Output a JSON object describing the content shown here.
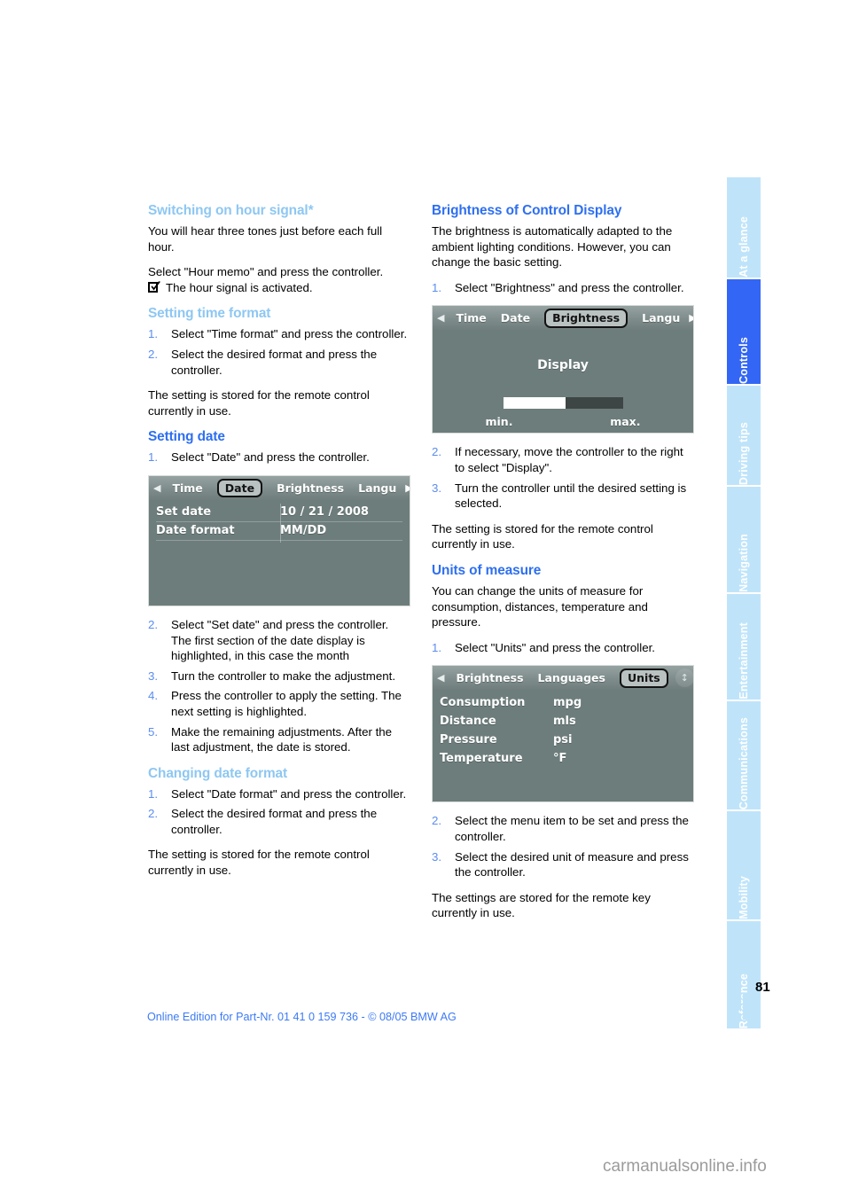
{
  "document": {
    "page_number": "81",
    "footer_note": "Online Edition for Part-Nr. 01 41 0 159 736 - © 08/05 BMW AG",
    "watermark": "carmanualsonline.info"
  },
  "sidebar": {
    "tabs": [
      {
        "label": "At a glance",
        "active": false
      },
      {
        "label": "Controls",
        "active": true
      },
      {
        "label": "Driving tips",
        "active": false
      },
      {
        "label": "Navigation",
        "active": false
      },
      {
        "label": "Entertainment",
        "active": false
      },
      {
        "label": "Communications",
        "active": false
      },
      {
        "label": "Mobility",
        "active": false
      },
      {
        "label": "Reference",
        "active": false
      }
    ],
    "colors": {
      "tab_bg": "#bfe4fa",
      "tab_active_bg": "#3366f5",
      "tab_text": "#ffffff"
    }
  },
  "left_column": {
    "section_hour_signal": {
      "heading": "Switching on hour signal*",
      "para1": "You will hear three tones just before each full hour.",
      "para2": "Select \"Hour memo\" and press the controller.",
      "checkbox_line": "The hour signal is activated."
    },
    "section_time_format": {
      "heading": "Setting time format",
      "steps": [
        {
          "num": "1.",
          "text": "Select \"Time format\" and press the controller."
        },
        {
          "num": "2.",
          "text": "Select the desired format and press the controller."
        }
      ],
      "closing": "The setting is stored for the remote control currently in use."
    },
    "section_setting_date": {
      "heading": "Setting date",
      "step1": {
        "num": "1.",
        "text": "Select \"Date\" and press the controller."
      },
      "screenshot": {
        "menu_items": [
          "Time",
          "Date",
          "Brightness",
          "Langu"
        ],
        "selected_menu_item": "Date",
        "left_arrow": "◀",
        "right_arrow": "▶",
        "updown_icon": "↕",
        "rows": [
          {
            "label": "Set date",
            "value": "10 / 21 / 2008"
          },
          {
            "label": "Date format",
            "value": "MM/DD"
          }
        ]
      },
      "steps": [
        {
          "num": "2.",
          "text": "Select \"Set date\" and press the controller. The first section of the date display is highlighted, in this case the month"
        },
        {
          "num": "3.",
          "text": "Turn the controller to make the adjustment."
        },
        {
          "num": "4.",
          "text": "Press the controller to apply the setting. The next setting is highlighted."
        },
        {
          "num": "5.",
          "text": "Make the remaining adjustments. After the last adjustment, the date is stored."
        }
      ]
    },
    "section_date_format": {
      "heading": "Changing date format",
      "steps": [
        {
          "num": "1.",
          "text": "Select \"Date format\" and press the controller."
        },
        {
          "num": "2.",
          "text": "Select the desired format and press the controller."
        }
      ],
      "closing": "The setting is stored for the remote control currently in use."
    }
  },
  "right_column": {
    "section_brightness": {
      "heading": "Brightness of Control Display",
      "para1": "The brightness is automatically adapted to the ambient lighting conditions. However, you can change the basic setting.",
      "step1": {
        "num": "1.",
        "text": "Select \"Brightness\" and press the controller."
      },
      "screenshot": {
        "menu_items": [
          "Time",
          "Date",
          "Brightness",
          "Langu"
        ],
        "selected_menu_item": "Brightness",
        "left_arrow": "◀",
        "right_arrow": "▶",
        "updown_icon": "↕",
        "display_label": "Display",
        "slider_min_label": "min.",
        "slider_max_label": "max.",
        "slider_fill_percent": 52
      },
      "steps": [
        {
          "num": "2.",
          "text": "If necessary, move the controller to the right to select \"Display\"."
        },
        {
          "num": "3.",
          "text": "Turn the controller until the desired setting is selected."
        }
      ],
      "closing": "The setting is stored for the remote control currently in use."
    },
    "section_units": {
      "heading": "Units of measure",
      "para1": "You can change the units of measure for consumption, distances, temperature and pressure.",
      "step1": {
        "num": "1.",
        "text": "Select \"Units\" and press the controller."
      },
      "screenshot": {
        "menu_items": [
          "Brightness",
          "Languages",
          "Units"
        ],
        "selected_menu_item": "Units",
        "left_arrow": "◀",
        "updown_icon": "↕",
        "rows": [
          {
            "label": "Consumption",
            "value": "mpg"
          },
          {
            "label": "Distance",
            "value": "mls"
          },
          {
            "label": "Pressure",
            "value": "psi"
          },
          {
            "label": "Temperature",
            "value": "°F"
          }
        ]
      },
      "steps": [
        {
          "num": "2.",
          "text": "Select the menu item to be set and press the controller."
        },
        {
          "num": "3.",
          "text": "Select the desired unit of measure and press the controller."
        }
      ],
      "closing": "The settings are stored for the remote key currently in use."
    }
  }
}
